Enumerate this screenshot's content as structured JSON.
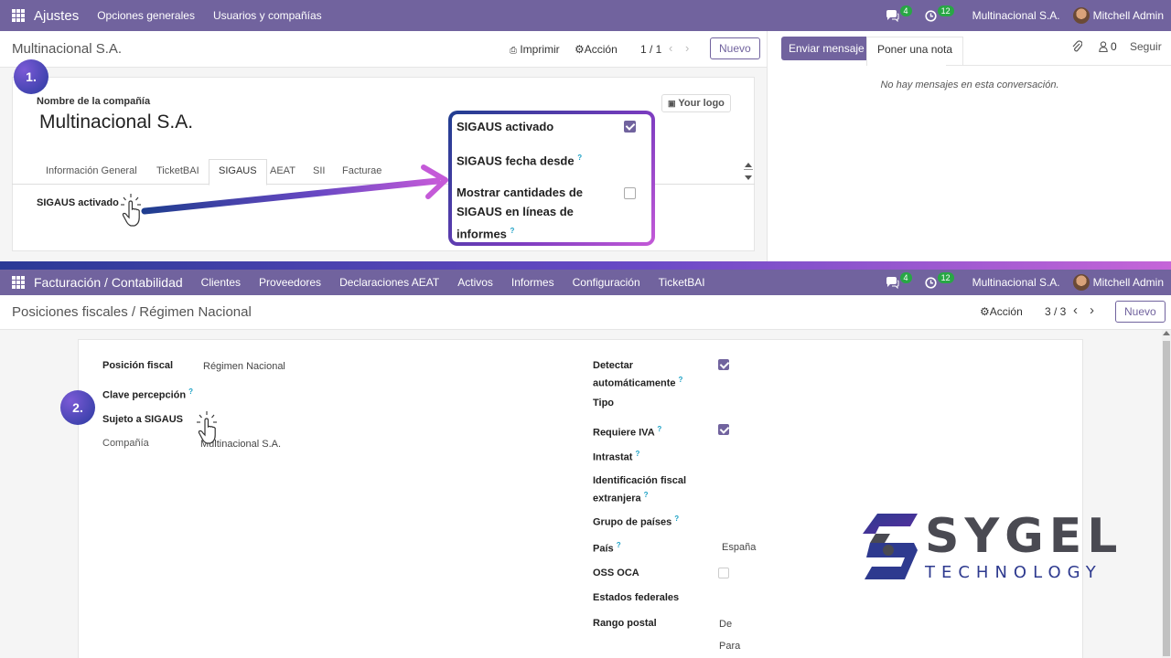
{
  "top_nav": {
    "brand": "Ajustes",
    "menus": [
      "Opciones generales",
      "Usuarios y compañías"
    ],
    "messages_count": "4",
    "activities_count": "12",
    "company": "Multinacional S.A.",
    "user": "Mitchell Admin"
  },
  "top_control": {
    "breadcrumb": "Multinacional S.A.",
    "print_label": "Imprimir",
    "action_label": "Acción",
    "pager": "1 / 1",
    "new_label": "Nuevo"
  },
  "chatter": {
    "send_message": "Enviar mensaje",
    "log_note": "Poner una nota",
    "followers_count": "0",
    "follow_label": "Seguir",
    "empty_text": "No hay mensajes en esta conversación."
  },
  "company_form": {
    "step_number": "1.",
    "name_label": "Nombre de la compañía",
    "name_value": "Multinacional S.A.",
    "logo_label": "Your logo",
    "tabs": [
      "Información General",
      "TicketBAI",
      "SIGAUS",
      "AEAT",
      "SII",
      "Facturae"
    ],
    "field_label": "SIGAUS activado"
  },
  "popup": {
    "sigaus_activado": "SIGAUS activado",
    "sigaus_activado_checked": true,
    "sigaus_fecha": "SIGAUS fecha desde",
    "mostrar_line1": "Mostrar cantidades de",
    "mostrar_line2": "SIGAUS en líneas de",
    "mostrar_line3": "informes",
    "mostrar_checked": false
  },
  "bottom_nav": {
    "brand": "Facturación / Contabilidad",
    "menus": [
      "Clientes",
      "Proveedores",
      "Declaraciones AEAT",
      "Activos",
      "Informes",
      "Configuración",
      "TicketBAI"
    ],
    "messages_count": "4",
    "activities_count": "12",
    "company": "Multinacional S.A.",
    "user": "Mitchell Admin"
  },
  "bottom_control": {
    "breadcrumb_parent": "Posiciones fiscales",
    "breadcrumb_sep": "/",
    "breadcrumb_current": "Régimen Nacional",
    "action_label": "Acción",
    "pager": "3 / 3",
    "new_label": "Nuevo"
  },
  "fiscal_form": {
    "step_number": "2.",
    "left": {
      "posicion_label": "Posición fiscal",
      "posicion_value": "Régimen Nacional",
      "clave_label": "Clave percepción",
      "sujeto_label": "Sujeto a SIGAUS",
      "compania_label": "Compañía",
      "compania_value": "Multinacional S.A."
    },
    "right": {
      "detectar_line1": "Detectar",
      "detectar_line2": "automáticamente",
      "detectar_checked": true,
      "tipo_label": "Tipo",
      "requiere_iva_label": "Requiere IVA",
      "requiere_iva_checked": true,
      "intrastat_label": "Intrastat",
      "id_fiscal_line1": "Identificación fiscal",
      "id_fiscal_line2": "extranjera",
      "grupo_paises_label": "Grupo de países",
      "pais_label": "País",
      "pais_value": "España",
      "oss_label": "OSS OCA",
      "oss_checked": false,
      "estados_label": "Estados federales",
      "rango_label": "Rango postal",
      "rango_de": "De",
      "rango_para": "Para"
    }
  },
  "watermark": {
    "name": "SYGEL",
    "sub": "TECHNOLOGY"
  },
  "colors": {
    "primary": "#71639e",
    "info": "#1aa0c4",
    "badge": "#28a745",
    "arrow_start": "#1f3d8f",
    "arrow_end": "#c45ad8"
  }
}
